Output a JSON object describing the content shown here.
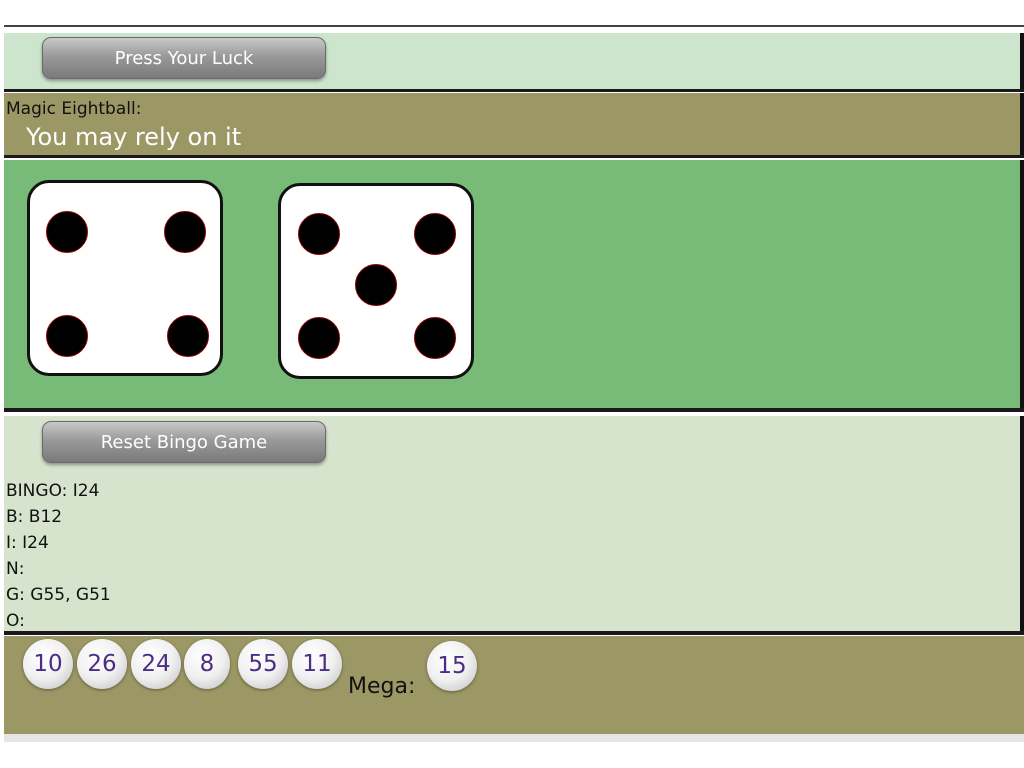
{
  "luck": {
    "button_label": "Press Your Luck"
  },
  "eightball": {
    "label": "Magic Eightball:",
    "answer": "You may rely on it"
  },
  "dice": [
    {
      "value": 4
    },
    {
      "value": 5
    }
  ],
  "bingo": {
    "button_label": "Reset Bingo Game",
    "lines": {
      "bingo": "BINGO: I24",
      "b": "B: B12",
      "i": "I: I24",
      "n": "N:",
      "g": "G: G55, G51",
      "o": "O:"
    }
  },
  "lottery": {
    "balls": [
      "10",
      "26",
      "24",
      "8",
      "55",
      "11"
    ],
    "mega_label": "Mega:",
    "mega_ball": "15"
  },
  "colors": {
    "luck_bg": "#cce5cc",
    "eightball_bg": "#9c9865",
    "dice_bg": "#78bb78",
    "bingo_bg": "#d6e4cd",
    "ball_text": "#4b2e83"
  }
}
